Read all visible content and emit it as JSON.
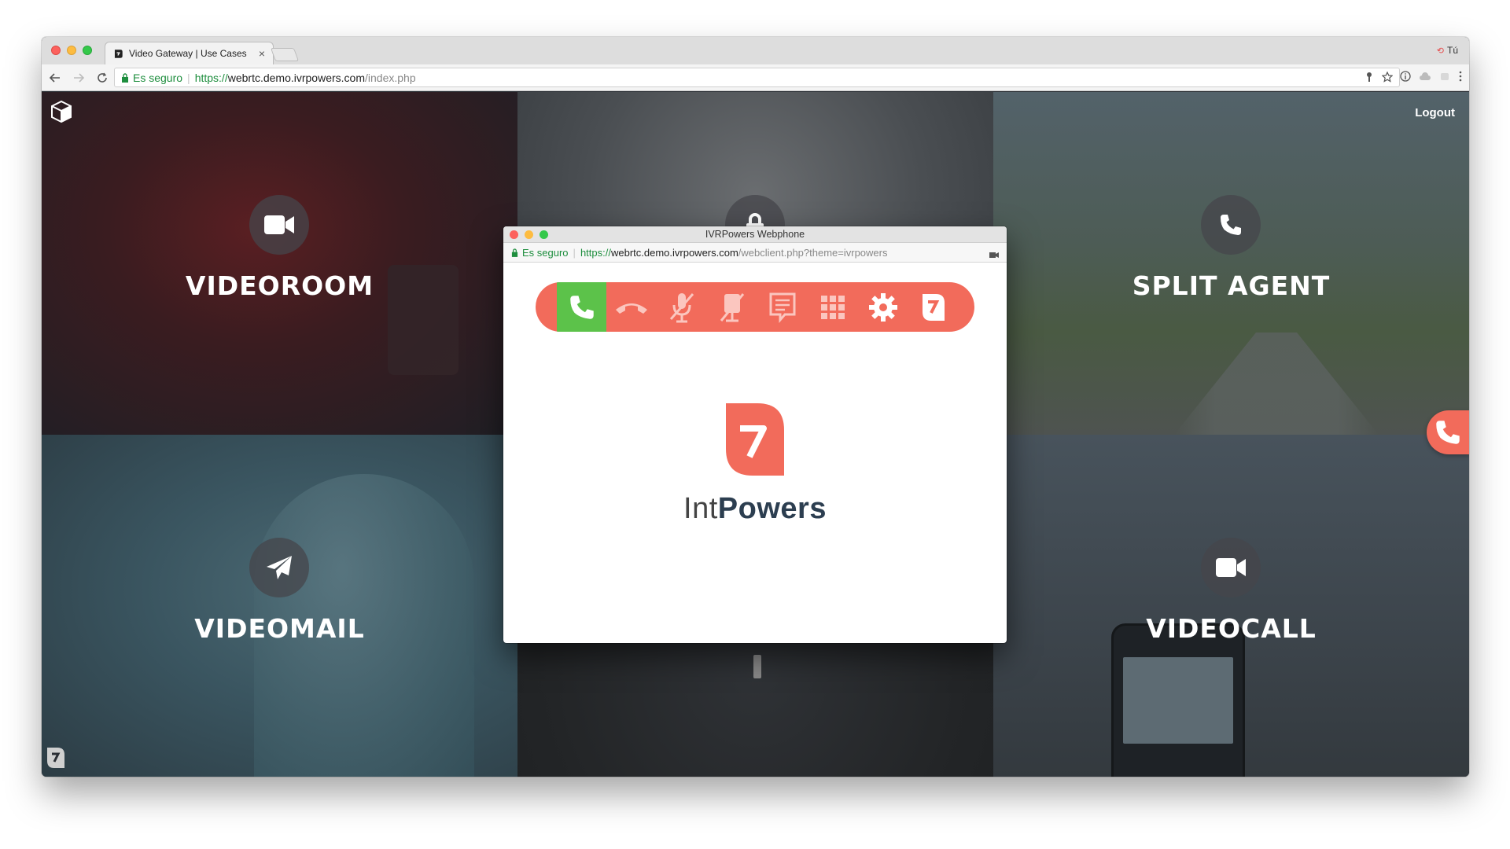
{
  "browser": {
    "tab_title": "Video Gateway | Use Cases",
    "profile_name": "Tú",
    "secure_label": "Es seguro",
    "url_scheme": "https://",
    "url_host": "webrtc.demo.ivrpowers.com",
    "url_path": "/index.php"
  },
  "page": {
    "logout_label": "Logout",
    "tiles": [
      {
        "label": "VIDEOROOM",
        "icon": "video-camera-icon"
      },
      {
        "label": "",
        "icon": "lock-icon"
      },
      {
        "label": "SPLIT AGENT",
        "icon": "phone-icon"
      },
      {
        "label": "VIDEOMAIL",
        "icon": "paper-plane-icon"
      },
      {
        "label": "",
        "icon": ""
      },
      {
        "label": "VIDEOCALL",
        "icon": "video-camera-icon"
      }
    ]
  },
  "popup": {
    "window_title": "IVRPowers Webphone",
    "secure_label": "Es seguro",
    "url_scheme": "https://",
    "url_host": "webrtc.demo.ivrpowers.com",
    "url_path": "/webclient.php?theme=ivrpowers",
    "callbar": [
      "phone-call-icon",
      "hangup-icon",
      "mute-mic-icon",
      "mute-video-icon",
      "chat-icon",
      "dialpad-icon",
      "settings-gear-icon",
      "ivrpowers-logo-icon"
    ],
    "brand_light": "Int",
    "brand_bold": "Powers"
  },
  "colors": {
    "accent": "#f26b5b",
    "call_green": "#5cc24a",
    "brand_text": "#2c3e50"
  }
}
